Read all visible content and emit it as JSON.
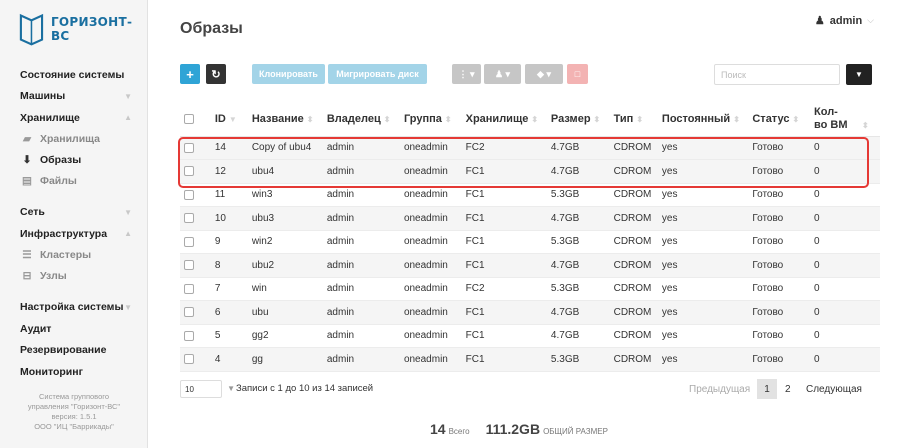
{
  "brand": {
    "name": "ГОРИЗОНТ-ВС"
  },
  "sidebar": {
    "items": [
      {
        "label": "Состояние системы"
      },
      {
        "label": "Машины"
      },
      {
        "label": "Хранилище"
      },
      {
        "label": "Хранилища"
      },
      {
        "label": "Образы"
      },
      {
        "label": "Файлы"
      },
      {
        "label": "Сеть"
      },
      {
        "label": "Инфраструктура"
      },
      {
        "label": "Кластеры"
      },
      {
        "label": "Узлы"
      },
      {
        "label": "Настройка системы"
      },
      {
        "label": "Аудит"
      },
      {
        "label": "Резервирование"
      },
      {
        "label": "Мониторинг"
      }
    ],
    "footer": [
      "Система группового",
      "управления \"Горизонт-ВС\"",
      "версия: 1.5.1",
      "ООО \"ИЦ \"Баррикады\""
    ]
  },
  "header": {
    "title": "Образы",
    "user": "admin"
  },
  "toolbar": {
    "clone_label": "Клонировать",
    "migrate_label": "Мигрировать диск",
    "search_placeholder": "Поиск"
  },
  "table": {
    "columns": [
      "ID",
      "Название",
      "Владелец",
      "Группа",
      "Хранилище",
      "Размер",
      "Тип",
      "Постоянный",
      "Статус",
      "Кол-во ВМ"
    ],
    "rows": [
      [
        "14",
        "Copy of ubu4",
        "admin",
        "oneadmin",
        "FC2",
        "4.7GB",
        "CDROM",
        "yes",
        "Готово",
        "0"
      ],
      [
        "12",
        "ubu4",
        "admin",
        "oneadmin",
        "FC1",
        "4.7GB",
        "CDROM",
        "yes",
        "Готово",
        "0"
      ],
      [
        "11",
        "win3",
        "admin",
        "oneadmin",
        "FC1",
        "5.3GB",
        "CDROM",
        "yes",
        "Готово",
        "0"
      ],
      [
        "10",
        "ubu3",
        "admin",
        "oneadmin",
        "FC1",
        "4.7GB",
        "CDROM",
        "yes",
        "Готово",
        "0"
      ],
      [
        "9",
        "win2",
        "admin",
        "oneadmin",
        "FC1",
        "5.3GB",
        "CDROM",
        "yes",
        "Готово",
        "0"
      ],
      [
        "8",
        "ubu2",
        "admin",
        "oneadmin",
        "FC1",
        "4.7GB",
        "CDROM",
        "yes",
        "Готово",
        "0"
      ],
      [
        "7",
        "win",
        "admin",
        "oneadmin",
        "FC2",
        "5.3GB",
        "CDROM",
        "yes",
        "Готово",
        "0"
      ],
      [
        "6",
        "ubu",
        "admin",
        "oneadmin",
        "FC1",
        "4.7GB",
        "CDROM",
        "yes",
        "Готово",
        "0"
      ],
      [
        "5",
        "gg2",
        "admin",
        "oneadmin",
        "FC1",
        "4.7GB",
        "CDROM",
        "yes",
        "Готово",
        "0"
      ],
      [
        "4",
        "gg",
        "admin",
        "oneadmin",
        "FC1",
        "5.3GB",
        "CDROM",
        "yes",
        "Готово",
        "0"
      ]
    ]
  },
  "pagination": {
    "per_page": "10",
    "records": "Записи с 1 до 10 из 14 записей",
    "prev": "Предыдущая",
    "pages": [
      "1",
      "2"
    ],
    "next": "Следующая"
  },
  "totals": {
    "count": "14",
    "count_label": "Всего",
    "size": "111.2GB",
    "size_label": "ОБЩИЙ РАЗМЕР"
  },
  "colors": {
    "accent": "#2fa4d6",
    "highlight": "#e53935"
  }
}
